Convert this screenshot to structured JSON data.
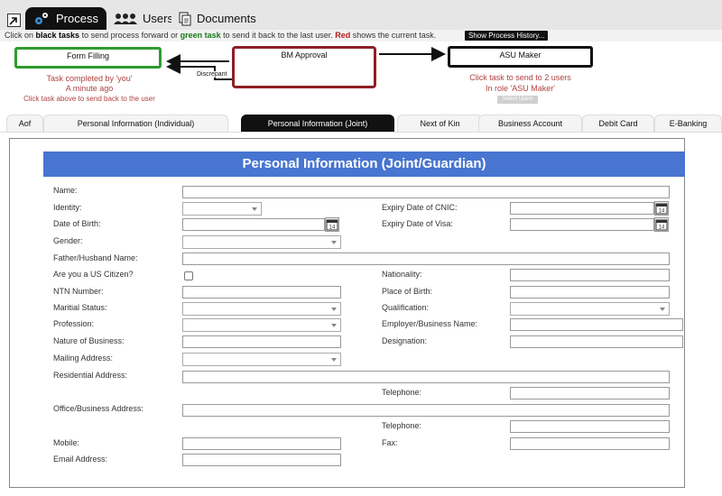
{
  "top_tabs": {
    "process": "Process",
    "users": "Users",
    "documents": "Documents"
  },
  "hint": {
    "part1": "Click on ",
    "black": "black tasks",
    "part2": " to send process forward or ",
    "green": "green task",
    "part3": " to send it back to the last user. ",
    "red": "Red",
    "part4": " shows the current task.",
    "history_button": "Show Process History..."
  },
  "flow": {
    "form_filling": {
      "label": "Form Filling",
      "note1": "Task completed by 'you'",
      "note2": "A minute ago",
      "note3": "Click task above to send back to the user"
    },
    "bm_approval": {
      "label": "BM Approval"
    },
    "discrepant": "Discrepant",
    "asu_maker": {
      "label": "ASU Maker",
      "note1": "Click task to send to 2 users",
      "note2": "In role 'ASU Maker'",
      "select_users": "Select Users"
    },
    "colors": {
      "completed": "#2e9b2e",
      "current": "#8e1f26",
      "forward": "#111111"
    }
  },
  "form_tabs": [
    "Aof",
    "Personal Information (Individual)",
    "Personal Information (Joint)",
    "Next of Kin",
    "Business Account",
    "Debit Card",
    "E-Banking"
  ],
  "active_form_tab": "Personal Information (Joint)",
  "form": {
    "title": "Personal Information (Joint/Guardian)",
    "accent": "#4775d1",
    "labels": {
      "name": "Name:",
      "identity": "Identity:",
      "expiry_cnic": "Expiry Date of CNIC:",
      "dob": "Date of Birth:",
      "expiry_visa": "Expiry Date of Visa:",
      "gender": "Gender:",
      "father_husband": "Father/Husband Name:",
      "us_citizen": "Are you a US Citizen?",
      "nationality": "Nationality:",
      "ntn": "NTN Number:",
      "place_of_birth": "Place of Birth:",
      "marital_status": "Maritial Status:",
      "qualification": "Qualification:",
      "profession": "Profession:",
      "employer": "Employer/Business Name:",
      "nature_business": "Nature of Business:",
      "designation": "Designation:",
      "mailing_address": "Mailing Address:",
      "residential_address": "Residential Address:",
      "telephone1": "Telephone:",
      "office_address": "Office/Business Address:",
      "telephone2": "Telephone:",
      "mobile": "Mobile:",
      "fax": "Fax:",
      "email": "Email Address:"
    },
    "values": {
      "name": "",
      "identity": "",
      "expiry_cnic": "",
      "dob": "",
      "expiry_visa": "",
      "gender": "",
      "father_husband": "",
      "us_citizen": false,
      "nationality": "",
      "ntn": "",
      "place_of_birth": "",
      "marital_status": "",
      "qualification": "",
      "profession": "",
      "employer": "",
      "nature_business": "",
      "designation": "",
      "mailing_address": "",
      "residential_address": "",
      "telephone1": "",
      "office_address": "",
      "telephone2": "",
      "mobile": "",
      "fax": "",
      "email": ""
    }
  }
}
